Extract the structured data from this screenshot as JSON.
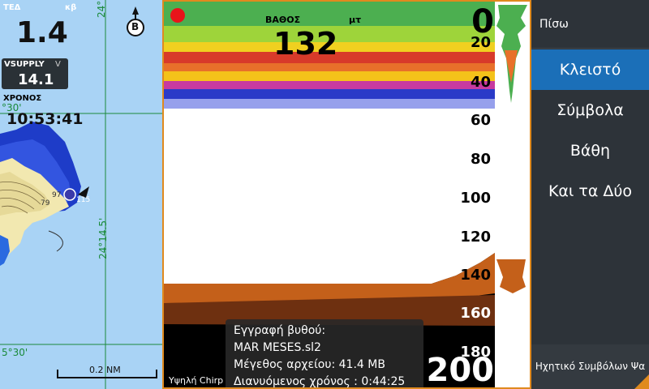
{
  "chart": {
    "sog": {
      "label": "ΤΕΔ",
      "unit": "κβ",
      "value": "1.4"
    },
    "vsupply": {
      "label": "VSUPPLY",
      "unit": "V",
      "value": "14.1"
    },
    "time": {
      "label": "ΧΡΟΝΟΣ",
      "value": "10:53:41"
    },
    "north_icon": "north-up-icon",
    "north_letter": "B",
    "grid_labels": [
      "24°",
      "°30'",
      "24°14.5'",
      "5°30'"
    ],
    "sounding_labels": [
      "97",
      "79",
      "115"
    ],
    "scale": "0.2 NM"
  },
  "sonar": {
    "depth_label": "ΒΑΘΟΣ",
    "depth_unit": "μτ",
    "depth_value": "132",
    "range_top": "0",
    "range_bottom": "200",
    "depth_ticks": [
      "20",
      "40",
      "60",
      "80",
      "100",
      "120",
      "140",
      "160",
      "180"
    ],
    "frequency_label": "Υψηλή Chirp",
    "recording": {
      "title": "Εγγραφή βυθού:",
      "file": "MAR MESES.sl2",
      "size": "Μέγεθος αρχείου: 41.4 MB",
      "elapsed": "Διανυόμενος χρόνος :  0:44:25"
    },
    "colors": {
      "border": "#e08a1e",
      "record": "#e8141a",
      "bottom": "#c4601a"
    }
  },
  "menu": {
    "back": "Πίσω",
    "items": [
      "Κλειστό",
      "Σύμβολα",
      "Βάθη",
      "Και τα Δύο"
    ],
    "selected_index": 0,
    "footer": "Ηχητικό Συμβόλων Ψα",
    "selected_color": "#1b6fb8"
  }
}
